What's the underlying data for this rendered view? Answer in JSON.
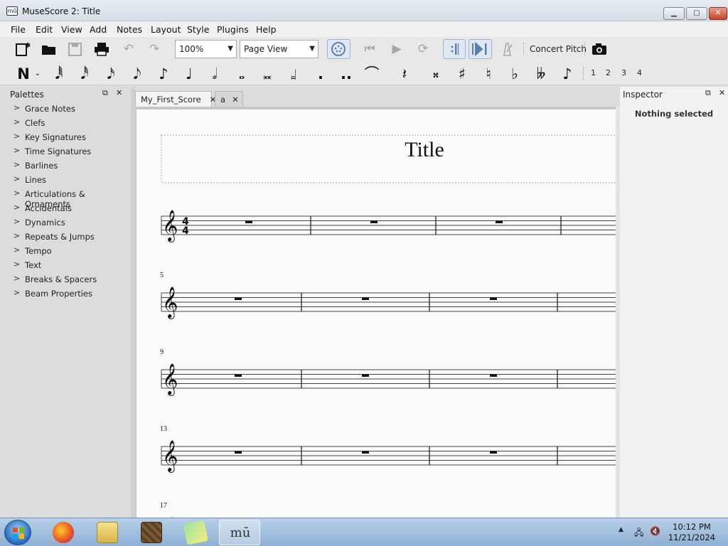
{
  "window": {
    "title": "MuseScore 2: Title",
    "app_icon": "mū"
  },
  "menu": [
    "File",
    "Edit",
    "View",
    "Add",
    "Notes",
    "Layout",
    "Style",
    "Plugins",
    "Help"
  ],
  "toolbar": {
    "zoom": "100%",
    "view_mode": "Page View",
    "concert_pitch": "Concert Pitch"
  },
  "note_input": {
    "durations": [
      "𝅘𝅥𝅯",
      "𝅘𝅥𝅮",
      "♪",
      "♩",
      "𝅗𝅥",
      "𝅝"
    ],
    "voices": [
      "1",
      "2",
      "3",
      "4"
    ],
    "accidentals": [
      "𝄪",
      "♯",
      "♮",
      "♭",
      "𝄫"
    ]
  },
  "palettes": {
    "title": "Palettes",
    "items": [
      "Grace Notes",
      "Clefs",
      "Key Signatures",
      "Time Signatures",
      "Barlines",
      "Lines",
      "Articulations & Ornaments",
      "Accidentals",
      "Dynamics",
      "Repeats & Jumps",
      "Tempo",
      "Text",
      "Breaks & Spacers",
      "Beam Properties"
    ]
  },
  "tabs": [
    {
      "label": "My_First_Score",
      "active": true
    },
    {
      "label": "a",
      "active": false
    }
  ],
  "score": {
    "title": "Title",
    "time_signature": {
      "top": "4",
      "bottom": "4"
    },
    "system_measure_numbers": [
      "",
      "5",
      "9",
      "13",
      "17"
    ]
  },
  "inspector": {
    "title": "Inspector",
    "status": "Nothing selected"
  },
  "taskbar": {
    "time": "10:12 PM",
    "date": "11/21/2024"
  },
  "colors": {
    "accent": "#2e6fb5",
    "taskbar": "#9dbbd9",
    "page": "#fafafa"
  }
}
